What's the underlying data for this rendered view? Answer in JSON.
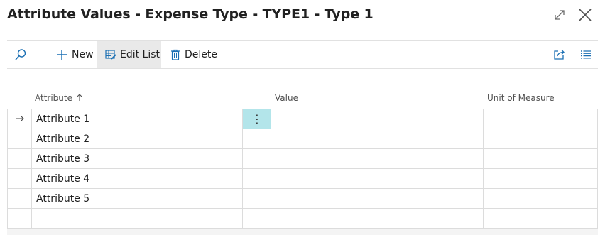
{
  "window": {
    "title": "Attribute Values - Expense Type - TYPE1 - Type 1",
    "expand_icon": "expand-icon",
    "close_icon": "close-icon"
  },
  "toolbar": {
    "search_icon": "search-icon",
    "new_label": "New",
    "edit_list_label": "Edit List",
    "delete_label": "Delete",
    "share_icon": "share-icon",
    "list_view_icon": "list-view-icon"
  },
  "table": {
    "columns": {
      "attribute": "Attribute",
      "attribute_sort_icon": "sort-ascending-icon",
      "value": "Value",
      "unit_of_measure": "Unit of Measure"
    },
    "rows": [
      {
        "attribute": "Attribute 1",
        "value": "",
        "unit_of_measure": "",
        "selected": true
      },
      {
        "attribute": "Attribute 2",
        "value": "",
        "unit_of_measure": ""
      },
      {
        "attribute": "Attribute 3",
        "value": "",
        "unit_of_measure": ""
      },
      {
        "attribute": "Attribute 4",
        "value": "",
        "unit_of_measure": ""
      },
      {
        "attribute": "Attribute 5",
        "value": "",
        "unit_of_measure": ""
      },
      {
        "attribute": "",
        "value": "",
        "unit_of_measure": ""
      }
    ],
    "selected_row_marker": "→",
    "row_actions_glyph": "⋮"
  },
  "colors": {
    "accent": "#1a6fb3",
    "selected_cell": "#b3e5ea",
    "edit_list_highlight": "#e9e9e9"
  }
}
